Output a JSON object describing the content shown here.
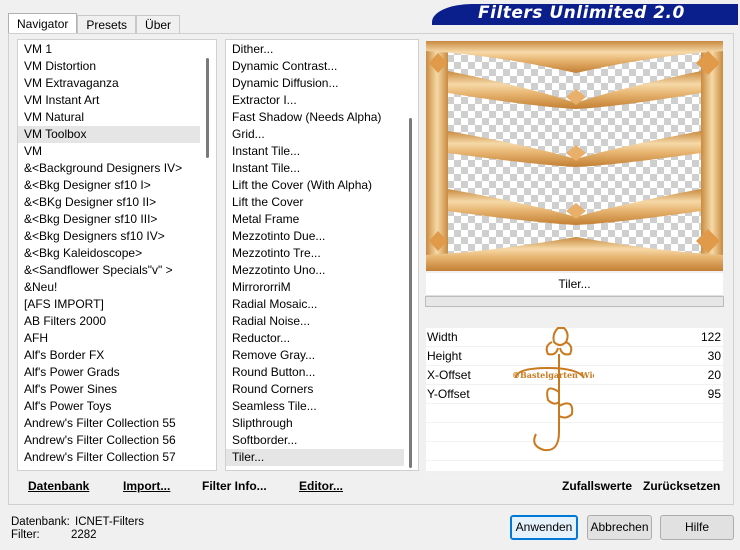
{
  "tabs": [
    "Navigator",
    "Presets",
    "Über"
  ],
  "title": "Filters Unlimited 2.0",
  "categories": [
    "VM 1",
    "VM Distortion",
    "VM Extravaganza",
    "VM Instant Art",
    "VM Natural",
    "VM Toolbox",
    "VM",
    "&<Background Designers IV>",
    "&<Bkg Designer sf10 I>",
    "&<BKg Designer sf10 II>",
    "&<Bkg Designer sf10 III>",
    "&<Bkg Designers sf10 IV>",
    "&<Bkg Kaleidoscope>",
    "&<Sandflower Specials\"v\" >",
    "&Neu!",
    "[AFS IMPORT]",
    "AB Filters 2000",
    "AFH",
    "Alf's Border FX",
    "Alf's Power Grads",
    "Alf's Power Sines",
    "Alf's Power Toys",
    "Andrew's Filter Collection 55",
    "Andrew's Filter Collection 56",
    "Andrew's Filter Collection 57"
  ],
  "filters": [
    "Dither...",
    "Dynamic Contrast...",
    "Dynamic Diffusion...",
    "Extractor I...",
    "Fast Shadow (Needs Alpha)",
    "Grid...",
    "Instant Tile...",
    "Instant Tile...",
    "Lift the Cover (With Alpha)",
    "Lift the Cover",
    "Metal Frame",
    "Mezzotinto Due...",
    "Mezzotinto Tre...",
    "Mezzotinto Uno...",
    "MirrororriM",
    "Radial Mosaic...",
    "Radial Noise...",
    "Reductor...",
    "Remove Gray...",
    "Round Button...",
    "Round Corners",
    "Seamless Tile...",
    "Slipthrough",
    "Softborder...",
    "Tiler..."
  ],
  "selected_category": "VM Toolbox",
  "selected_filter": "Tiler...",
  "filter_name_label": "Tiler...",
  "params": [
    {
      "name": "Width",
      "value": "122"
    },
    {
      "name": "Height",
      "value": "30"
    },
    {
      "name": "X-Offset",
      "value": "20"
    },
    {
      "name": "Y-Offset",
      "value": "95"
    }
  ],
  "watermark": "©Bastelgarten Wien",
  "bottom_buttons": {
    "database": "Datenbank",
    "import": "Import...",
    "filter_info": "Filter Info...",
    "editor": "Editor...",
    "random": "Zufallswerte",
    "reset": "Zurücksetzen"
  },
  "info": {
    "db_label": "Datenbank:",
    "db_value": "ICNET-Filters",
    "filter_label": "Filter:",
    "filter_value": "2282"
  },
  "dialog_buttons": {
    "apply": "Anwenden",
    "cancel": "Abbrechen",
    "help": "Hilfe"
  },
  "colors": {
    "banner": "#0a1e8c",
    "wood_light": "#f6d9a8",
    "wood_dark": "#c98a3e",
    "watermark": "#c97a1e"
  }
}
